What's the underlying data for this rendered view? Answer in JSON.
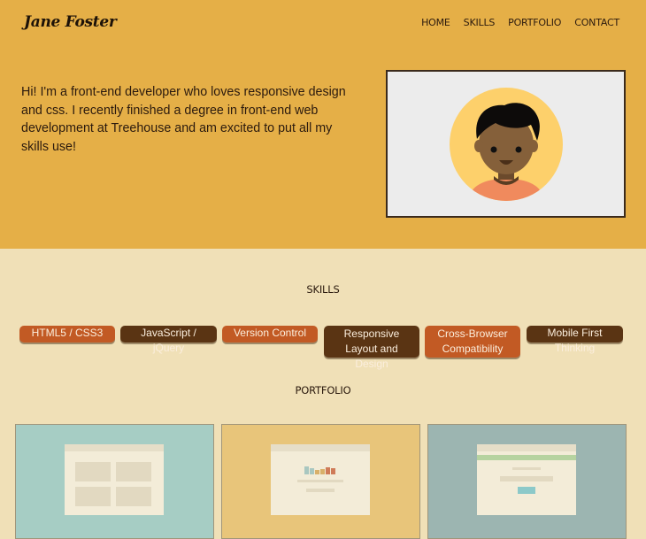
{
  "header": {
    "logo": "Jane Foster",
    "nav": [
      "HOME",
      "SKILLS",
      "PORTFOLIO",
      "CONTACT"
    ]
  },
  "hero": {
    "intro": "Hi! I'm a front-end developer who loves responsive design and css. I recently finished a degree in front-end web development at Treehouse and am excited to put all my skills use!"
  },
  "skills": {
    "title": "SKILLS",
    "items": [
      {
        "label": "HTML5 / CSS3",
        "color": "#c25a24"
      },
      {
        "label": "JavaScript / jQuery",
        "color": "#5a3413"
      },
      {
        "label": "Version Control",
        "color": "#c25a24"
      },
      {
        "label": "Responsive Layout and Design",
        "color": "#5a3413"
      },
      {
        "label": "Cross-Browser Compatibility",
        "color": "#c25a24"
      },
      {
        "label": "Mobile First Thinking",
        "color": "#5a3413"
      }
    ]
  },
  "portfolio": {
    "title": "PORTFOLIO",
    "cards": [
      {
        "background": "#a6cdc4"
      },
      {
        "background": "#e8c57a"
      },
      {
        "background": "#9cb5b1"
      }
    ]
  },
  "colors": {
    "hero_bg": "#e5af47",
    "page_bg": "#f0e0b7"
  }
}
